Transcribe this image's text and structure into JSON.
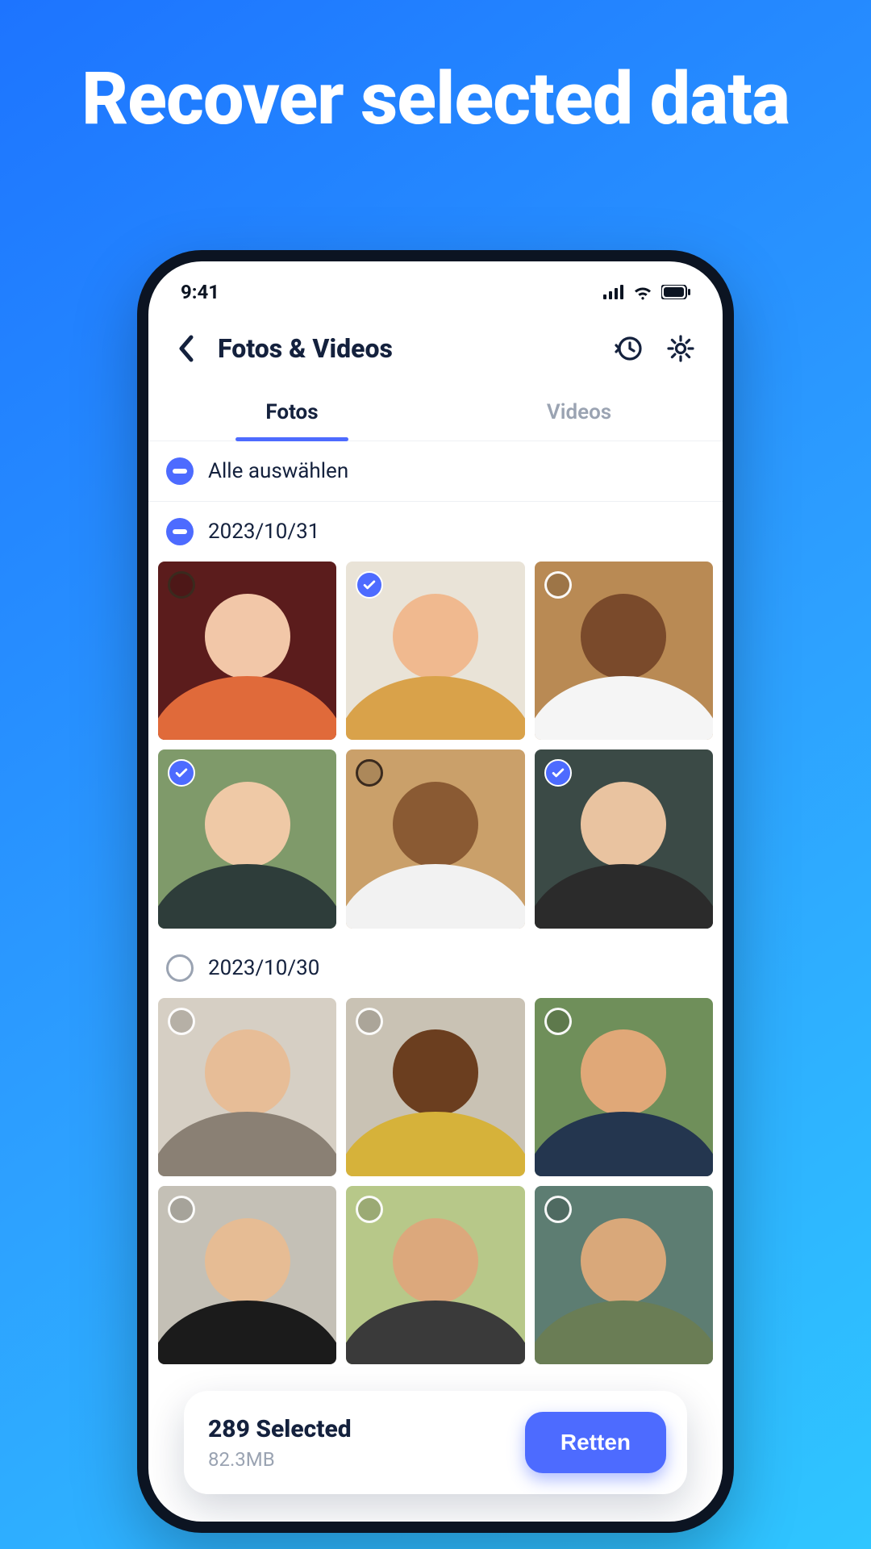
{
  "promo": {
    "title": "Recover selected data"
  },
  "statusbar": {
    "time": "9:41"
  },
  "header": {
    "title": "Fotos & Videos"
  },
  "tabs": {
    "photos": "Fotos",
    "videos": "Videos",
    "active": "photos"
  },
  "select_all": {
    "label": "Alle auswählen"
  },
  "groups": [
    {
      "date": "2023/10/31",
      "indeterminate": true,
      "items": [
        {
          "selected": false,
          "badge": "unchecked-dark",
          "bg": "#5b1c1c",
          "skin": "#f2c7a8",
          "cloth": "#e06a3a"
        },
        {
          "selected": true,
          "badge": "checked",
          "bg": "#e9e3d7",
          "skin": "#f0b98f",
          "cloth": "#d9a24a"
        },
        {
          "selected": false,
          "badge": "unchecked",
          "bg": "#b98a54",
          "skin": "#7a4a2b",
          "cloth": "#f5f5f5"
        },
        {
          "selected": true,
          "badge": "checked",
          "bg": "#7f9a6a",
          "skin": "#efc9a6",
          "cloth": "#2e3d3a"
        },
        {
          "selected": false,
          "badge": "unchecked-dark",
          "bg": "#caa06a",
          "skin": "#8a5a33",
          "cloth": "#f2f2f2"
        },
        {
          "selected": true,
          "badge": "checked",
          "bg": "#3b4a46",
          "skin": "#e9c3a0",
          "cloth": "#2b2b2b"
        }
      ]
    },
    {
      "date": "2023/10/30",
      "indeterminate": false,
      "items": [
        {
          "selected": false,
          "badge": "unchecked",
          "bg": "#d6cfc4",
          "skin": "#e7bd97",
          "cloth": "#8a8074"
        },
        {
          "selected": false,
          "badge": "unchecked",
          "bg": "#c9c2b4",
          "skin": "#6b3e1f",
          "cloth": "#d6b23a"
        },
        {
          "selected": false,
          "badge": "unchecked",
          "bg": "#6f8f5a",
          "skin": "#e0a878",
          "cloth": "#24364f"
        },
        {
          "selected": false,
          "badge": "unchecked",
          "bg": "#c4c0b6",
          "skin": "#e6bc94",
          "cloth": "#1b1b1b"
        },
        {
          "selected": false,
          "badge": "unchecked",
          "bg": "#b7c889",
          "skin": "#dca87c",
          "cloth": "#3a3a3a"
        },
        {
          "selected": false,
          "badge": "unchecked",
          "bg": "#5d7d72",
          "skin": "#d9a87a",
          "cloth": "#6a7d55"
        }
      ]
    }
  ],
  "action": {
    "title": "289 Selected",
    "sub": "82.3MB",
    "button": "Retten"
  }
}
